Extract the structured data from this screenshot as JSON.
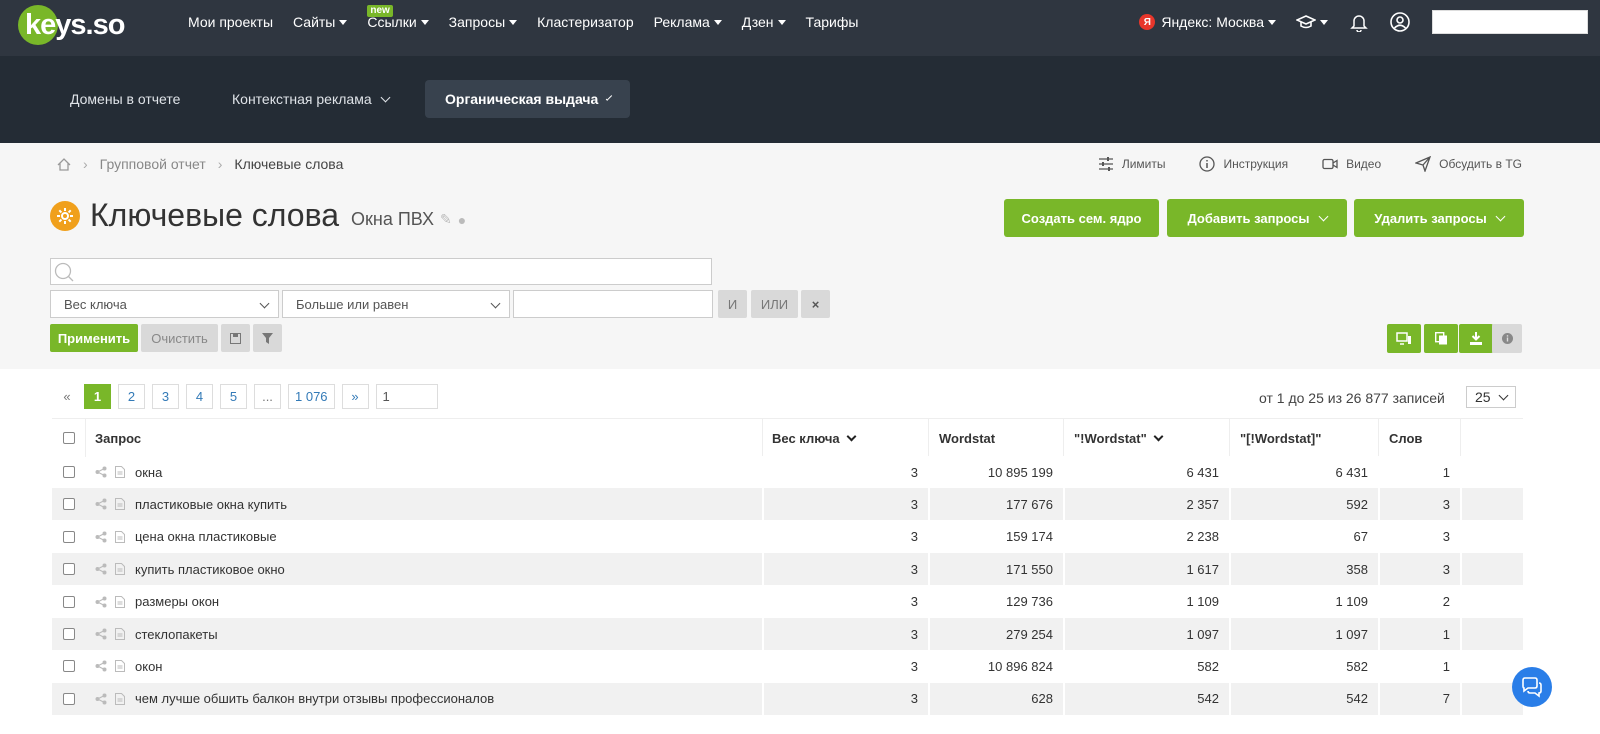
{
  "topnav": {
    "logo": "keys.so",
    "items": [
      {
        "label": "Мои проекты",
        "caret": false
      },
      {
        "label": "Сайты",
        "caret": true
      },
      {
        "label": "Ссылки",
        "caret": true,
        "badge": "new"
      },
      {
        "label": "Запросы",
        "caret": true
      },
      {
        "label": "Кластеризатор",
        "caret": false
      },
      {
        "label": "Реклама",
        "caret": true
      },
      {
        "label": "Дзен",
        "caret": true
      },
      {
        "label": "Тарифы",
        "caret": false
      }
    ],
    "region_icon": "Я",
    "region": "Яндекс: Москва"
  },
  "subnav": {
    "tabs": [
      {
        "label": "Домены в отчете"
      },
      {
        "label": "Контекстная реклама"
      },
      {
        "label": "Органическая выдача"
      }
    ]
  },
  "breadcrumb": {
    "items": [
      "Групповой отчет",
      "Ключевые слова"
    ]
  },
  "toplinks": [
    "Лимиты",
    "Инструкция",
    "Видео",
    "Обсудить в TG"
  ],
  "page": {
    "title": "Ключевые слова",
    "subtitle": "Окна ПВХ"
  },
  "actions": {
    "create": "Создать сем. ядро",
    "add": "Добавить запросы",
    "delete": "Удалить запросы"
  },
  "filters": {
    "field": "Вес ключа",
    "operator": "Больше или равен",
    "and": "И",
    "or": "ИЛИ",
    "close": "×",
    "apply": "Применить",
    "clear": "Очистить"
  },
  "pagination": {
    "prev": "«",
    "pages": [
      "1",
      "2",
      "3",
      "4",
      "5",
      "...",
      "1 076"
    ],
    "next": "»",
    "jump": "1",
    "records": "от 1 до 25 из 26 877 записей",
    "per_page": "25"
  },
  "table": {
    "headers": [
      "Запрос",
      "Вес ключа",
      "Wordstat",
      "\"!Wordstat\"",
      "\"[!Wordstat]\"",
      "Слов"
    ],
    "rows": [
      {
        "query": "окна",
        "weight": "3",
        "wordstat": "10 895 199",
        "excl": "6 431",
        "exact": "6 431",
        "words": "1"
      },
      {
        "query": "пластиковые окна купить",
        "weight": "3",
        "wordstat": "177 676",
        "excl": "2 357",
        "exact": "592",
        "words": "3"
      },
      {
        "query": "цена окна пластиковые",
        "weight": "3",
        "wordstat": "159 174",
        "excl": "2 238",
        "exact": "67",
        "words": "3"
      },
      {
        "query": "купить пластиковое окно",
        "weight": "3",
        "wordstat": "171 550",
        "excl": "1 617",
        "exact": "358",
        "words": "3"
      },
      {
        "query": "размеры окон",
        "weight": "3",
        "wordstat": "129 736",
        "excl": "1 109",
        "exact": "1 109",
        "words": "2"
      },
      {
        "query": "стеклопакеты",
        "weight": "3",
        "wordstat": "279 254",
        "excl": "1 097",
        "exact": "1 097",
        "words": "1"
      },
      {
        "query": "окон",
        "weight": "3",
        "wordstat": "10 896 824",
        "excl": "582",
        "exact": "582",
        "words": "1"
      },
      {
        "query": "чем лучше обшить балкон внутри отзывы профессионалов",
        "weight": "3",
        "wordstat": "628",
        "excl": "542",
        "exact": "542",
        "words": "7"
      }
    ]
  }
}
